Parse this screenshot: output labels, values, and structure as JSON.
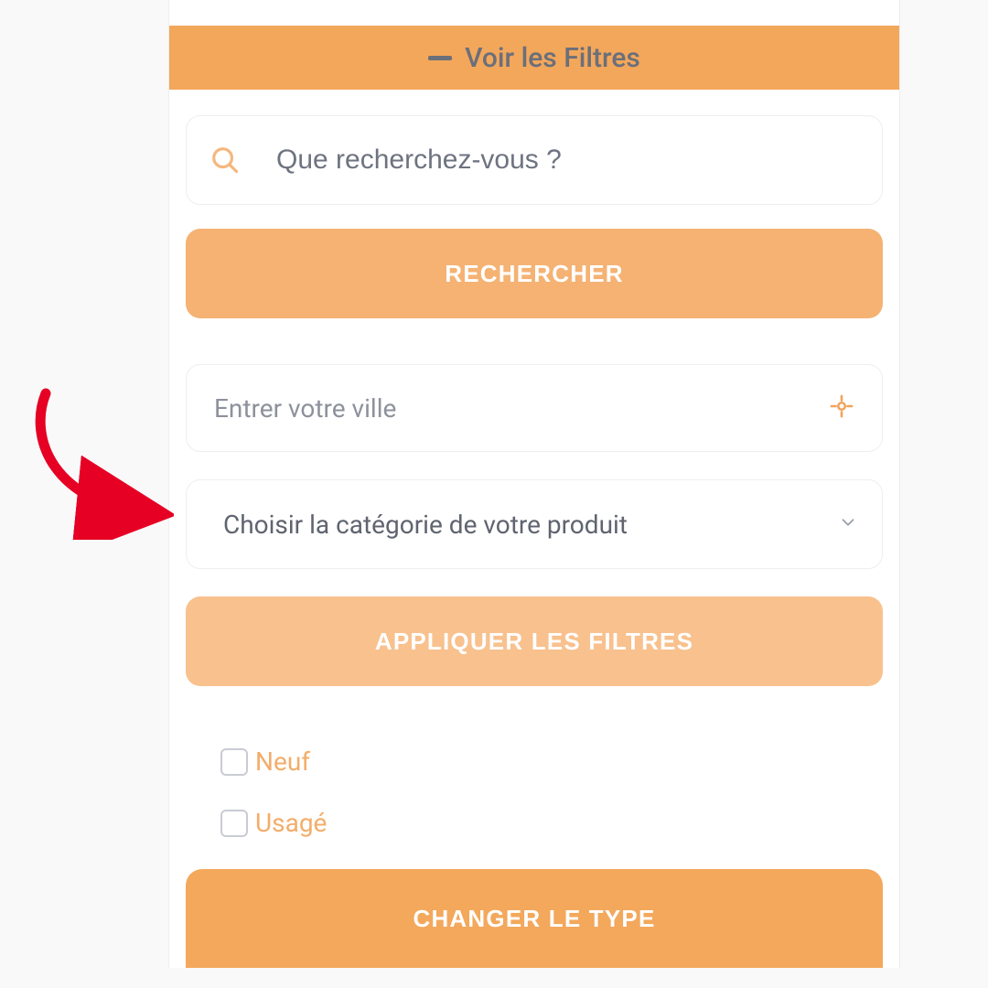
{
  "colors": {
    "accent": "#f3a75b",
    "accent_light": "#f5b273",
    "accent_lighter": "#f8c18e",
    "accent_strong": "#f3a85c",
    "text_muted": "#6e7380",
    "text_header": "#6b6f7a",
    "label": "#f3ad6a",
    "annotation": "#e60023"
  },
  "header": {
    "title": "Voir les Filtres"
  },
  "search": {
    "placeholder": "Que recherchez-vous ?",
    "button_label": "RECHERCHER"
  },
  "city": {
    "placeholder": "Entrer votre ville"
  },
  "category": {
    "placeholder": "Choisir la catégorie de votre produit"
  },
  "apply_button_label": "APPLIQUER LES FILTRES",
  "condition": {
    "options": [
      {
        "label": "Neuf",
        "checked": false
      },
      {
        "label": "Usagé",
        "checked": false
      }
    ]
  },
  "change_type_label": "CHANGER LE TYPE"
}
